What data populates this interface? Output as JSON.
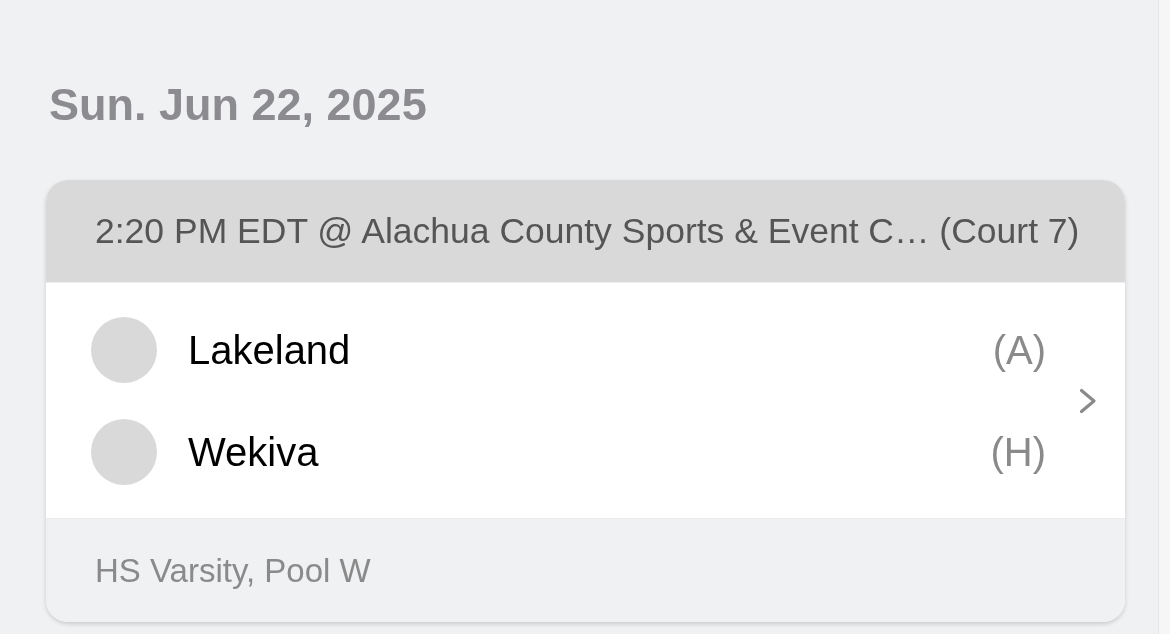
{
  "date_heading": "Sun. Jun 22, 2025",
  "game": {
    "header": "2:20 PM EDT @ Alachua County Sports & Event C… (Court 7)",
    "teams": [
      {
        "name": "Lakeland",
        "side": "(A)"
      },
      {
        "name": "Wekiva",
        "side": "(H)"
      }
    ],
    "division": "HS Varsity, Pool W"
  }
}
